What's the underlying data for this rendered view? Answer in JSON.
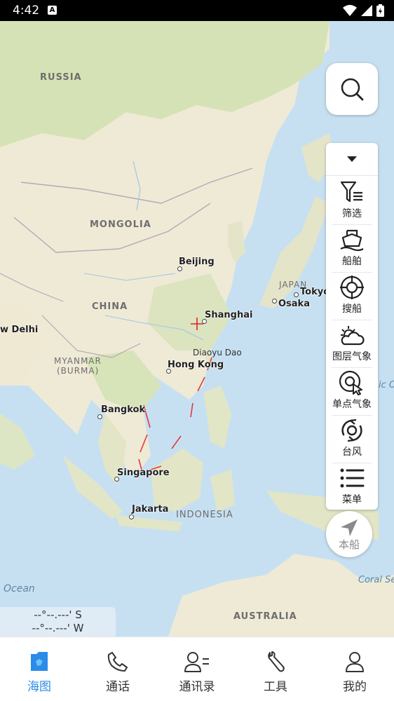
{
  "status_bar": {
    "time": "4:42",
    "notification_icon": "A"
  },
  "map": {
    "labels": {
      "russia": "RUSSIA",
      "mongolia": "MONGOLIA",
      "china": "CHINA",
      "myanmar": "MYANMAR",
      "myanmar_alt": "(BURMA)",
      "japan": "JAPAN",
      "indonesia": "INDONESIA",
      "australia": "AUSTRALIA",
      "beijing": "Beijing",
      "shanghai": "Shanghai",
      "tokyo": "Tokyo",
      "osaka": "Osaka",
      "hong_kong": "Hong Kong",
      "diaoyu_dao": "Diaoyu Dao",
      "bangkok": "Bangkok",
      "singapore": "Singapore",
      "jakarta": "Jakarta",
      "new_delhi": "w Delhi",
      "ocean": "Ocean",
      "coral_sea": "Coral Se",
      "pacific": "ic O"
    },
    "colors": {
      "land": "#eee9d6",
      "forest": "#d6e2b8",
      "water": "#c9e2f2",
      "border": "#b9a9b6",
      "dashed_line": "#e23a3a",
      "crosshair": "#d9232b"
    }
  },
  "search": {
    "icon": "search-icon"
  },
  "tool_panel": {
    "collapse_icon": "caret-down-icon",
    "items": [
      {
        "id": "filter",
        "label": "筛选",
        "icon": "filter-icon"
      },
      {
        "id": "ship",
        "label": "船舶",
        "icon": "ship-icon"
      },
      {
        "id": "search_ship",
        "label": "搜船",
        "icon": "crosshair-icon"
      },
      {
        "id": "layer_weather",
        "label": "图层气象",
        "icon": "cloud-sun-icon"
      },
      {
        "id": "point_weather",
        "label": "单点气象",
        "icon": "point-weather-icon"
      },
      {
        "id": "typhoon",
        "label": "台风",
        "icon": "typhoon-icon"
      },
      {
        "id": "menu",
        "label": "菜单",
        "icon": "list-icon"
      }
    ]
  },
  "own_ship": {
    "label": "本船",
    "icon": "navigation-arrow-icon"
  },
  "coordinates": {
    "lat": "--°--.---' S",
    "lon": "--°--.---' W"
  },
  "bottom_nav": {
    "active": "chart",
    "accent": "#2a8be8",
    "items": [
      {
        "id": "chart",
        "label": "海图",
        "icon": "chart-book-icon"
      },
      {
        "id": "call",
        "label": "通话",
        "icon": "phone-icon"
      },
      {
        "id": "contacts",
        "label": "通讯录",
        "icon": "contacts-icon"
      },
      {
        "id": "tools",
        "label": "工具",
        "icon": "wrench-icon"
      },
      {
        "id": "mine",
        "label": "我的",
        "icon": "user-icon"
      }
    ]
  }
}
